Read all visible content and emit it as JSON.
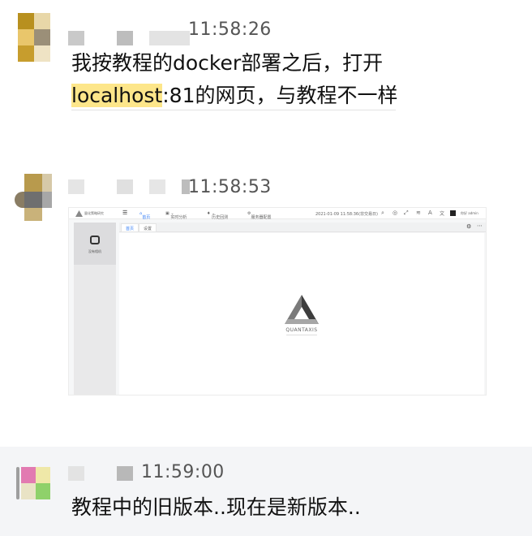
{
  "messages": [
    {
      "time": "11:58:26",
      "lines": [
        {
          "text": "我按教程的docker部署之后，打开"
        },
        {
          "highlight": "localhost",
          "rest": ":81的网页，与教程不一样"
        }
      ]
    },
    {
      "time": "11:58:53",
      "screenshot": {
        "brand": "量化策略研究",
        "menu_icon": "menu-icon",
        "nav": [
          "首页",
          "实时分析",
          "历史回测",
          "服务器配置"
        ],
        "datetime": "2021-01-09 11:58:36(非交易日)",
        "user_greeting": "你好 admin",
        "toolbar_icons": [
          "search-icon",
          "circle-icon",
          "expand-icon",
          "wifi-icon",
          "font-icon",
          "translate-icon",
          "dark-square-icon"
        ],
        "sidebar_label": "没有相机",
        "tabs": [
          "首页",
          "设置"
        ],
        "logo_text": "QUANTAXIS"
      }
    },
    {
      "time": "11:59:00",
      "lines": [
        {
          "text": "教程中的旧版本..现在是新版本.."
        }
      ]
    }
  ],
  "colors": {
    "highlight": "#fde68a",
    "accent_blue": "#3b82f6",
    "bottom_bg": "#f4f5f7"
  }
}
